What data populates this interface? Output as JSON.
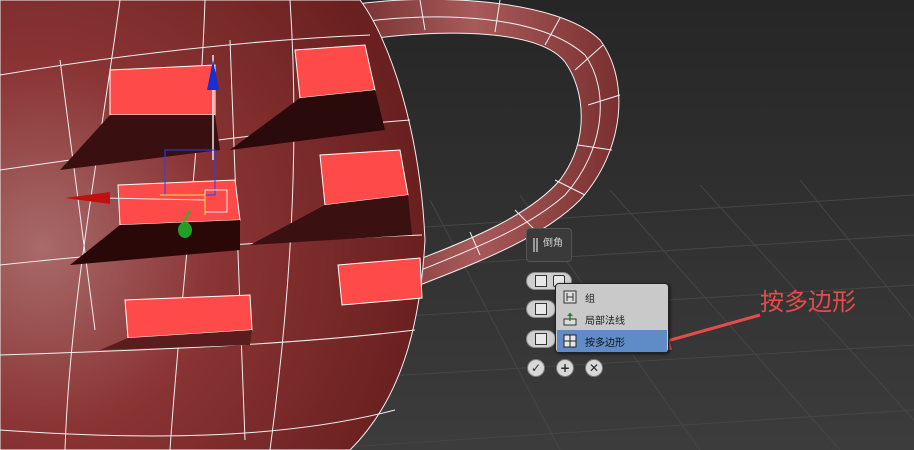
{
  "caddy": {
    "title": "倒角"
  },
  "dropdown": {
    "options": [
      {
        "label": "组",
        "icon": "group-icon",
        "selected": false
      },
      {
        "label": "局部法线",
        "icon": "local-normal-icon",
        "selected": false
      },
      {
        "label": "按多边形",
        "icon": "by-polygon-icon",
        "selected": true
      }
    ]
  },
  "actions": {
    "ok_icon": "checkmark-icon",
    "apply_icon": "plus-icon",
    "cancel_icon": "close-icon"
  },
  "annotation": {
    "text": "按多边形",
    "color": "#e34c4a"
  },
  "colors": {
    "viewport_bg": "#2e2e2e",
    "mesh": "#8c3232",
    "selected_face": "#ff4a4a",
    "highlight": "#5f8cc7"
  }
}
